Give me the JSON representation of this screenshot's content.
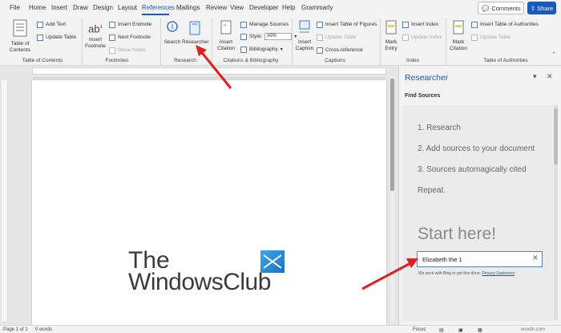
{
  "tabs": {
    "file": "File",
    "home": "Home",
    "insert": "Insert",
    "draw": "Draw",
    "design": "Design",
    "layout": "Layout",
    "references": "References",
    "mailings": "Mailings",
    "review": "Review",
    "developer": "Developer",
    "help": "Help",
    "grammarly": "Grammarly",
    "active": "References"
  },
  "top_right": {
    "comments": "Comments",
    "share": "Share"
  },
  "ribbon": {
    "toc": {
      "table_of_contents": "Table of Contents",
      "add_text": "Add Text",
      "update_table": "Update Table",
      "group": "Table of Contents"
    },
    "footnotes": {
      "insert_footnote": "Insert Footnote",
      "insert_endnote": "Insert Endnote",
      "next_footnote": "Next Footnote",
      "show_notes": "Show Notes",
      "group": "Footnotes"
    },
    "research": {
      "search": "Search",
      "researcher": "Researcher",
      "group": "Research"
    },
    "citations": {
      "insert_citation": "Insert Citation",
      "manage_sources": "Manage Sources",
      "style_label": "Style:",
      "style_value": "APA",
      "bibliography": "Bibliography",
      "group": "Citations & Bibliography"
    },
    "captions": {
      "insert_caption": "Insert Caption",
      "insert_table_of_figures": "Insert Table of Figures",
      "update_table": "Update Table",
      "cross_reference": "Cross-reference",
      "group": "Captions"
    },
    "index": {
      "mark_entry": "Mark Entry",
      "insert_index": "Insert Index",
      "update_index": "Update Index",
      "group": "Index"
    },
    "authorities": {
      "mark_citation": "Mark Citation",
      "insert_table_of_authorities": "Insert Table of Authorities",
      "update_table": "Update Table",
      "group": "Table of Authorities"
    }
  },
  "document": {
    "logo_line1": "The",
    "logo_line2": "WindowsClub"
  },
  "researcher": {
    "title": "Researcher",
    "find_sources": "Find Sources",
    "steps": [
      "1. Research",
      "2. Add sources to your document",
      "3. Sources automagically cited",
      "Repeat."
    ],
    "start_here": "Start here!",
    "search_value": "Elizabeth the 1",
    "bing_text": "We work with Bing to get this done.",
    "privacy_link": "Privacy Statement"
  },
  "status_bar": {
    "page": "Page 1 of 1",
    "words": "0 words",
    "focus": "Focus",
    "watermark": "wsxdn.com"
  },
  "colors": {
    "accent": "#185abd",
    "arrow": "#e02020"
  }
}
